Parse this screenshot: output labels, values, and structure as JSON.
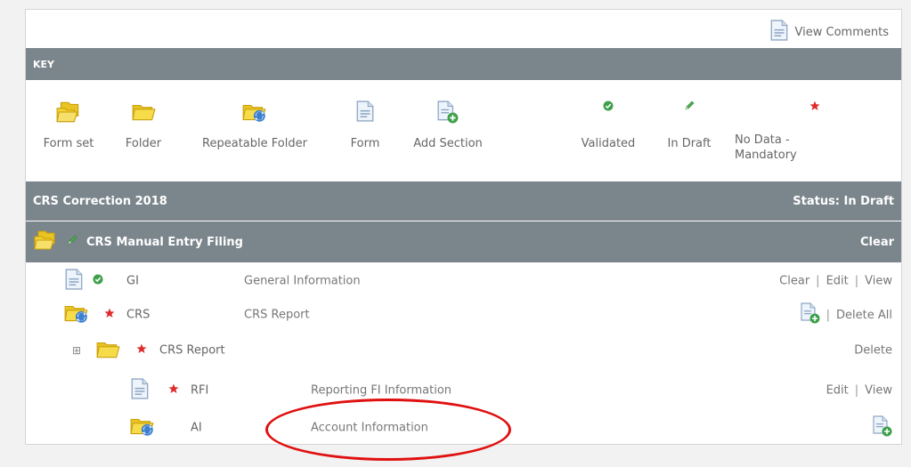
{
  "view_comments": "View Comments",
  "key": {
    "title": "KEY",
    "items": [
      {
        "label": "Form set",
        "icon": "form-set-icon"
      },
      {
        "label": "Folder",
        "icon": "folder-icon"
      },
      {
        "label": "Repeatable Folder",
        "icon": "repeatable-folder-icon"
      },
      {
        "label": "Form",
        "icon": "form-icon"
      },
      {
        "label": "Add Section",
        "icon": "add-section-icon"
      },
      {
        "label": "Validated",
        "icon": "validated-icon"
      },
      {
        "label": "In Draft",
        "icon": "in-draft-icon"
      },
      {
        "label": "No Data - Mandatory",
        "icon": "no-data-mandatory-icon"
      }
    ]
  },
  "filing": {
    "title": "CRS Correction 2018",
    "status": "Status: In Draft",
    "entry": {
      "name": "CRS Manual Entry Filing",
      "clear": "Clear"
    }
  },
  "rows": {
    "gi": {
      "code": "GI",
      "desc": "General Information",
      "clear": "Clear",
      "edit": "Edit",
      "view": "View"
    },
    "crs": {
      "code": "CRS",
      "desc": "CRS Report",
      "delete_all": "Delete All"
    },
    "crs_report": {
      "name": "CRS Report",
      "delete": "Delete",
      "expander": "⊞"
    },
    "rfi": {
      "code": "RFI",
      "desc": "Reporting FI Information",
      "edit": "Edit",
      "view": "View"
    },
    "ai": {
      "code": "AI",
      "desc": "Account Information"
    }
  },
  "separator": "|",
  "colors": {
    "header_bar": "#7b858c",
    "validated": "#3ea04a",
    "mandatory": "#e02b2b",
    "highlight_ellipse": "#e01010"
  }
}
